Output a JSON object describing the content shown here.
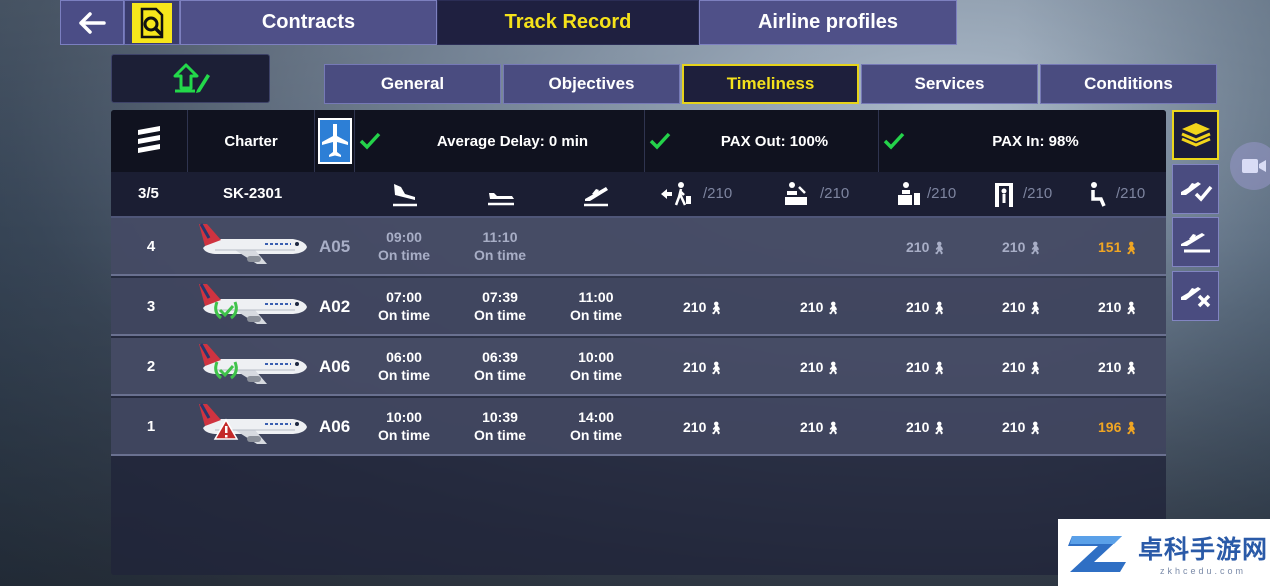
{
  "colors": {
    "accent": "#f5e21a",
    "warning": "#f0a623",
    "ok": "#24d24a",
    "tab": "#4f5088"
  },
  "top_tabs": [
    {
      "label": "Contracts",
      "active": false
    },
    {
      "label": "Track Record",
      "active": true
    },
    {
      "label": "Airline profiles",
      "active": false
    }
  ],
  "sub_tabs": [
    {
      "label": "General",
      "active": false
    },
    {
      "label": "Objectives",
      "active": false
    },
    {
      "label": "Timeliness",
      "active": true
    },
    {
      "label": "Services",
      "active": false
    },
    {
      "label": "Conditions",
      "active": false
    }
  ],
  "summary": {
    "contract_type": "Charter",
    "average_delay": "Average Delay: 0 min",
    "pax_out": "PAX Out: 100%",
    "pax_in": "PAX In: 98%"
  },
  "columns": {
    "progress": "3/5",
    "flight": "SK-2301",
    "capacity_deplane": "/210",
    "capacity_checkin": "/210",
    "capacity_baggage": "/210",
    "capacity_security": "/210",
    "capacity_boarding": "/210"
  },
  "rows": [
    {
      "num": "4",
      "gate": "A05",
      "badge": "none",
      "arrival": "09:00",
      "arrival_status": "On time",
      "departure": "11:10",
      "departure_status": "On time",
      "takeoff": "",
      "takeoff_status": "",
      "deplane": "",
      "checkin": "",
      "baggage": "210",
      "security": "210",
      "boarding": "151"
    },
    {
      "num": "3",
      "gate": "A02",
      "badge": "laurel",
      "arrival": "07:00",
      "arrival_status": "On time",
      "departure": "07:39",
      "departure_status": "On time",
      "takeoff": "11:00",
      "takeoff_status": "On time",
      "deplane": "210",
      "checkin": "210",
      "baggage": "210",
      "security": "210",
      "boarding": "210"
    },
    {
      "num": "2",
      "gate": "A06",
      "badge": "laurel",
      "arrival": "06:00",
      "arrival_status": "On time",
      "departure": "06:39",
      "departure_status": "On time",
      "takeoff": "10:00",
      "takeoff_status": "On time",
      "deplane": "210",
      "checkin": "210",
      "baggage": "210",
      "security": "210",
      "boarding": "210"
    },
    {
      "num": "1",
      "gate": "A06",
      "badge": "warning",
      "arrival": "10:00",
      "arrival_status": "On time",
      "departure": "10:39",
      "departure_status": "On time",
      "takeoff": "14:00",
      "takeoff_status": "On time",
      "deplane": "210",
      "checkin": "210",
      "baggage": "210",
      "security": "210",
      "boarding": "196"
    }
  ],
  "icons": {
    "back": "arrow-left-icon",
    "search_doc": "document-search-icon",
    "upload": "upload-edit-icon",
    "airline_logo": "airline-stripes-logo",
    "charter": "plane-charter-icon",
    "pax": "person-walking-icon",
    "camera": "video-camera-icon"
  },
  "watermark": {
    "title": "卓科手游网",
    "url": "zkhcedu.com"
  }
}
